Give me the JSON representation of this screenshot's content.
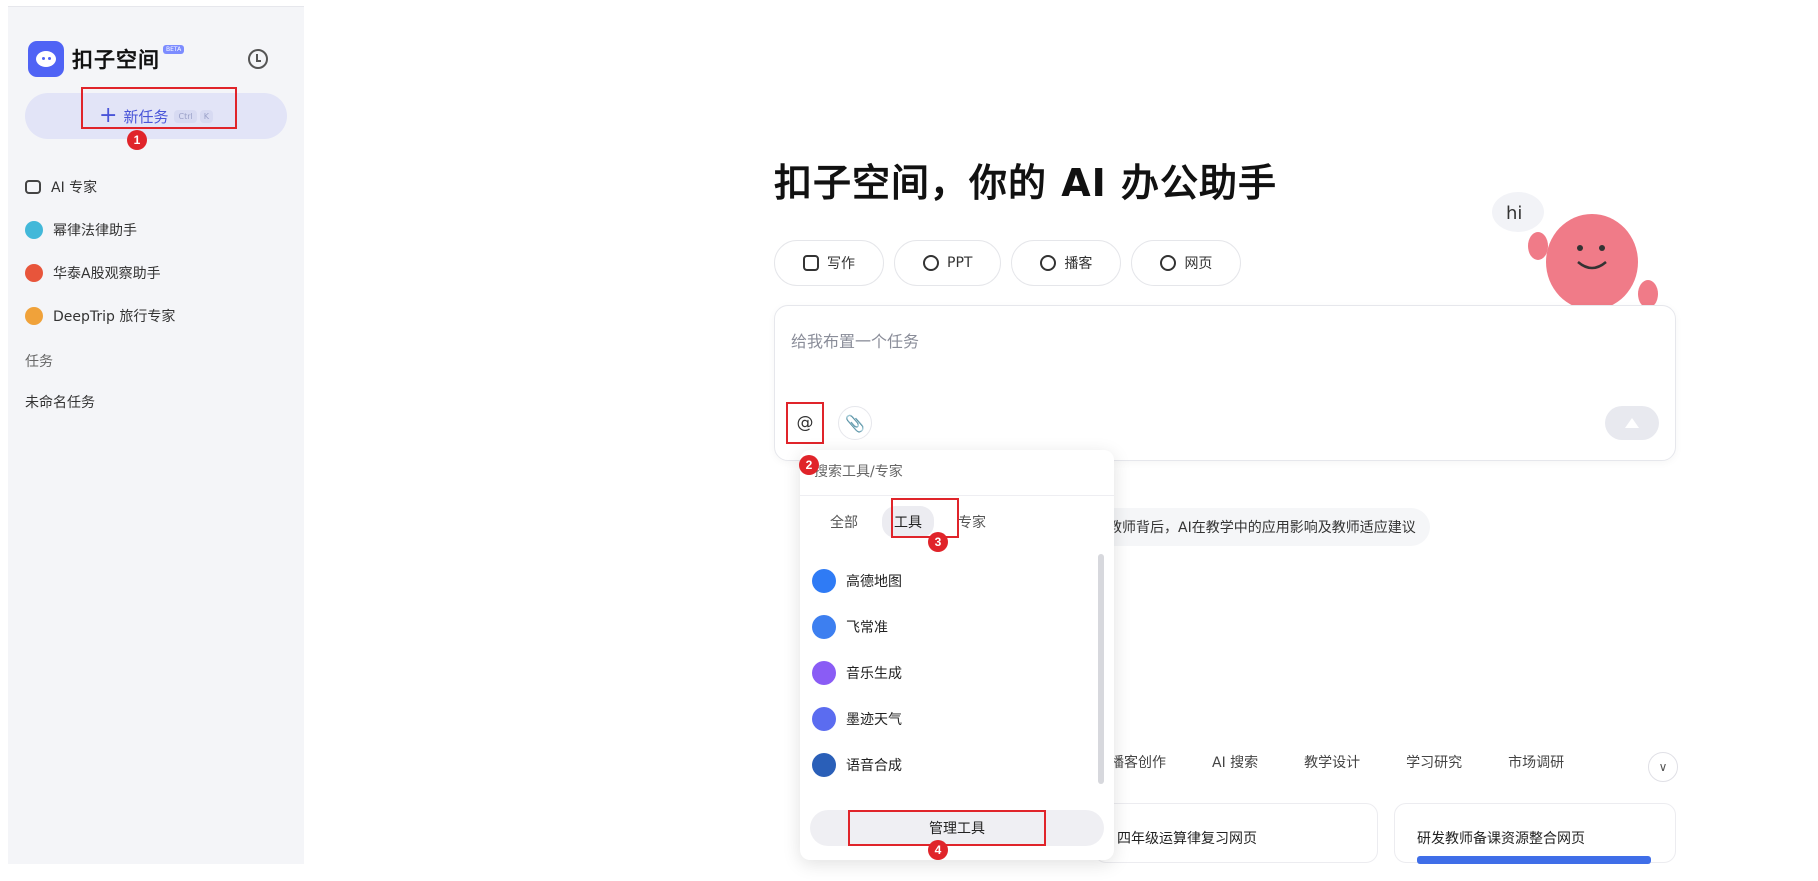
{
  "sidebar": {
    "brand": "扣子空间",
    "beta": "BETA",
    "new_task": "新任务",
    "new_task_kbd": [
      "Ctrl",
      "K"
    ],
    "nav": [
      {
        "label": "AI 专家",
        "icon": "graduation-cap-icon"
      },
      {
        "label": "幂律法律助手",
        "icon": "law-assistant-icon"
      },
      {
        "label": "华泰A股观察助手",
        "icon": "stock-assistant-icon"
      },
      {
        "label": "DeepTrip 旅行专家",
        "icon": "travel-expert-icon"
      }
    ],
    "section_label": "任务",
    "tasks": [
      "未命名任务"
    ]
  },
  "main": {
    "title": "扣子空间，你的 AI 办公助手",
    "mascot_bubble": "hi",
    "chips": [
      "写作",
      "PPT",
      "播客",
      "网页"
    ],
    "input_placeholder": "给我布置一个任务",
    "suggestion": "教师背后，AI在教学中的应用影响及教师适应建议",
    "categories": [
      "播客创作",
      "AI 搜索",
      "教学设计",
      "学习研究",
      "市场调研"
    ],
    "cards": [
      "四年级运算律复习网页",
      "研发教师备课资源整合网页"
    ]
  },
  "dropdown": {
    "search_placeholder": "搜索工具/专家",
    "tabs": [
      "全部",
      "工具",
      "专家"
    ],
    "active_tab": "工具",
    "items": [
      {
        "label": "高德地图",
        "color": "#2f7bf5"
      },
      {
        "label": "飞常准",
        "color": "#3d7ff0"
      },
      {
        "label": "音乐生成",
        "color": "#8a5cf5"
      },
      {
        "label": "墨迹天气",
        "color": "#5b6cf0"
      },
      {
        "label": "语音合成",
        "color": "#2a5fb8"
      }
    ],
    "manage": "管理工具"
  },
  "annotations": [
    "1",
    "2",
    "3",
    "4"
  ]
}
